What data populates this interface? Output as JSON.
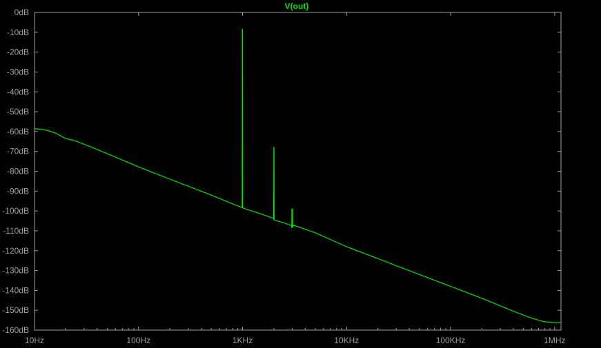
{
  "chart_data": {
    "type": "line",
    "title": "V(out)",
    "xlabel": "",
    "ylabel": "",
    "x_scale": "log",
    "xlim": [
      10,
      1000000
    ],
    "ylim": [
      -160,
      0
    ],
    "x_ticks": [
      10,
      100,
      1000,
      10000,
      100000,
      1000000
    ],
    "x_tick_labels": [
      "10Hz",
      "100Hz",
      "1KHz",
      "10KHz",
      "100KHz",
      "1MHz"
    ],
    "y_ticks": [
      0,
      -10,
      -20,
      -30,
      -40,
      -50,
      -60,
      -70,
      -80,
      -90,
      -100,
      -110,
      -120,
      -130,
      -140,
      -150,
      -160
    ],
    "y_tick_labels": [
      "0dB",
      "-10dB",
      "-20dB",
      "-30dB",
      "-40dB",
      "-50dB",
      "-60dB",
      "-70dB",
      "-80dB",
      "-90dB",
      "-100dB",
      "-110dB",
      "-120dB",
      "-130dB",
      "-140dB",
      "-150dB",
      "-160dB"
    ],
    "grid": false,
    "series": [
      {
        "name": "V(out)",
        "color": "#00e600",
        "points": [
          [
            10,
            -58.5
          ],
          [
            13,
            -59.3
          ],
          [
            16,
            -60.8
          ],
          [
            18,
            -62.3
          ],
          [
            20,
            -63.5
          ],
          [
            25,
            -64.8
          ],
          [
            40,
            -69
          ],
          [
            100,
            -77.8
          ],
          [
            200,
            -84
          ],
          [
            500,
            -92
          ],
          [
            900,
            -97.5
          ],
          [
            985,
            -98.2
          ],
          [
            992,
            -98.3
          ],
          [
            995,
            -60
          ],
          [
            997,
            -8.5
          ],
          [
            1000,
            -8.5
          ],
          [
            1002,
            -53
          ],
          [
            1004,
            -98.5
          ],
          [
            1020,
            -98.6
          ],
          [
            1500,
            -101.5
          ],
          [
            1980,
            -103.7
          ],
          [
            1990,
            -104.3
          ],
          [
            1995,
            -68
          ],
          [
            2005,
            -68
          ],
          [
            2010,
            -104.5
          ],
          [
            2500,
            -106
          ],
          [
            2950,
            -107.4
          ],
          [
            2970,
            -108.6
          ],
          [
            2980,
            -99
          ],
          [
            3020,
            -99
          ],
          [
            3030,
            -108
          ],
          [
            3100,
            -107.2
          ],
          [
            5000,
            -111
          ],
          [
            10000,
            -118
          ],
          [
            20000,
            -124
          ],
          [
            50000,
            -132
          ],
          [
            100000,
            -138
          ],
          [
            200000,
            -144
          ],
          [
            400000,
            -150.5
          ],
          [
            600000,
            -154
          ],
          [
            800000,
            -155.8
          ],
          [
            1000000,
            -156.2
          ],
          [
            1150000,
            -156.3
          ]
        ]
      }
    ]
  }
}
